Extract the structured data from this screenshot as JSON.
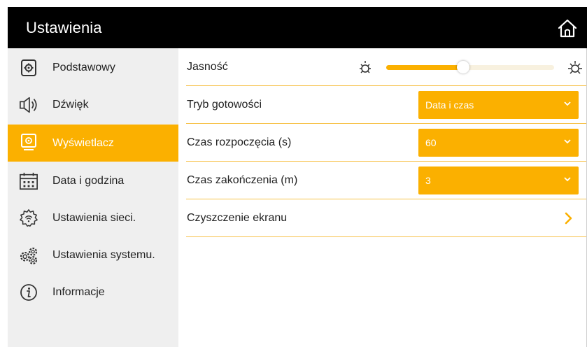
{
  "header": {
    "title": "Ustawienia",
    "home_icon": "home-icon"
  },
  "sidebar": {
    "items": [
      {
        "label": "Podstawowy",
        "icon": "gear-square-icon",
        "active": false
      },
      {
        "label": "Dźwięk",
        "icon": "speaker-icon",
        "active": false
      },
      {
        "label": "Wyświetlacz",
        "icon": "monitor-icon",
        "active": true
      },
      {
        "label": "Data i godzina",
        "icon": "calendar-icon",
        "active": false
      },
      {
        "label": "Ustawienia sieci.",
        "icon": "network-gear-icon",
        "active": false
      },
      {
        "label": "Ustawienia systemu.",
        "icon": "gears-icon",
        "active": false
      },
      {
        "label": "Informacje",
        "icon": "info-icon",
        "active": false
      }
    ]
  },
  "settings": {
    "brightness": {
      "label": "Jasność",
      "level_fraction": 0.46
    },
    "standby_mode": {
      "label": "Tryb gotowości",
      "value": "Data i czas"
    },
    "start_time": {
      "label": "Czas rozpoczęcia (s)",
      "value": "60"
    },
    "end_time": {
      "label": "Czas zakończenia (m)",
      "value": "3"
    },
    "screen_cleaning": {
      "label": "Czyszczenie ekranu"
    }
  },
  "colors": {
    "accent": "#fbb000",
    "header_bg": "#000000",
    "sidebar_bg": "#efefef",
    "divider": "#f7c24a",
    "slider_track": "#f8f1df"
  }
}
